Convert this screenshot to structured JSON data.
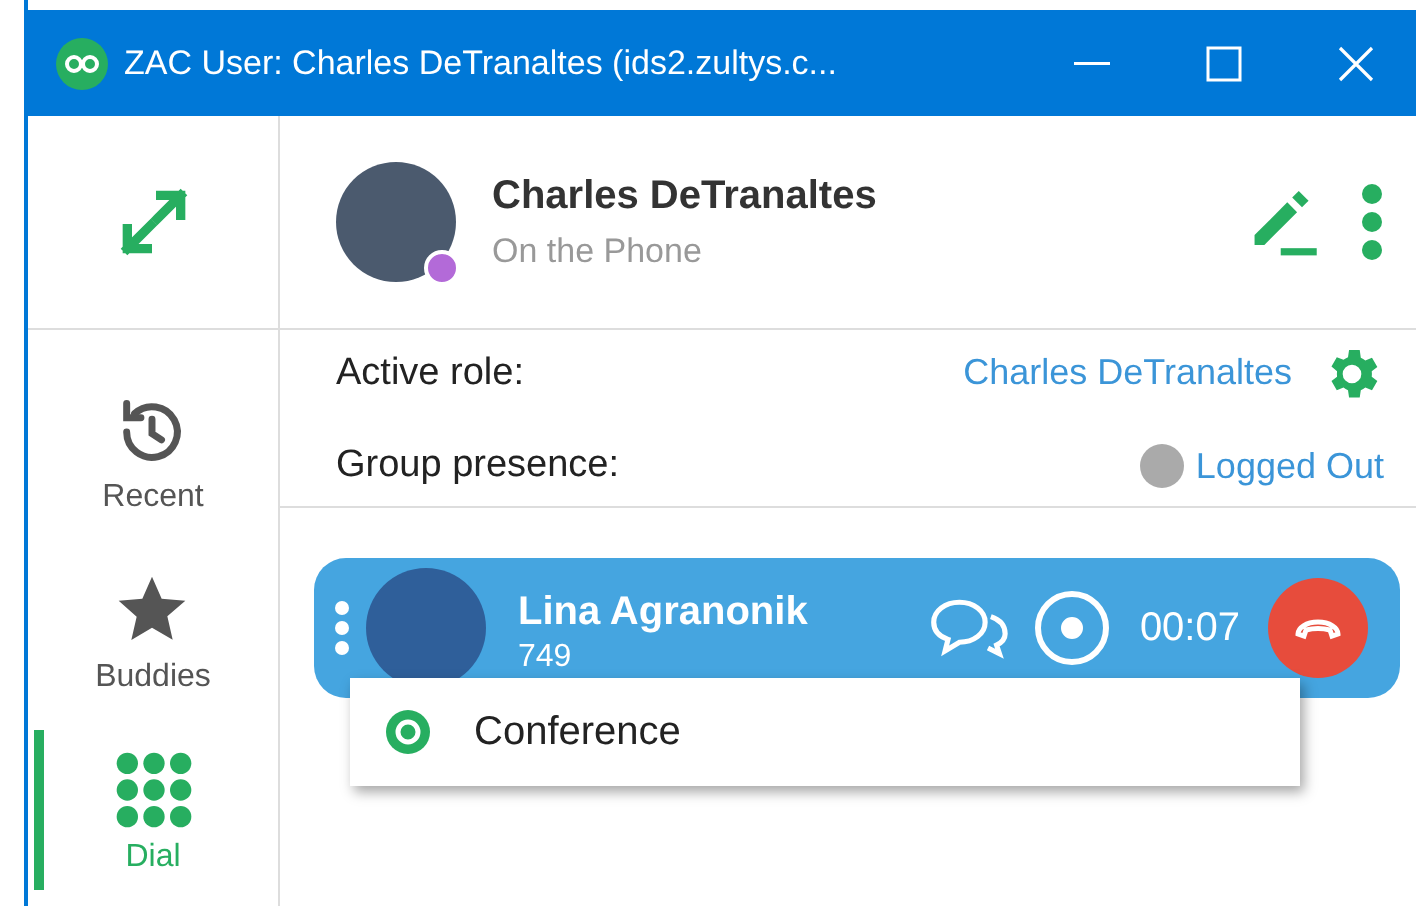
{
  "window": {
    "title": "ZAC User: Charles DeTranaltes (ids2.zultys.c..."
  },
  "sidebar": {
    "items": [
      {
        "kind": "recent",
        "label": "Recent",
        "selected": false
      },
      {
        "kind": "buddies",
        "label": "Buddies",
        "selected": false
      },
      {
        "kind": "dial",
        "label": "Dial",
        "selected": true
      }
    ]
  },
  "user": {
    "name": "Charles DeTranaltes",
    "status": "On the Phone"
  },
  "active_role": {
    "label": "Active role:",
    "value": "Charles DeTranaltes"
  },
  "group_presence": {
    "label": "Group presence:",
    "value": "Logged Out"
  },
  "call": {
    "name": "Lina Agranonik",
    "number": "749",
    "timer": "00:07"
  },
  "call_menu": {
    "items": [
      {
        "label": "Conference"
      }
    ]
  }
}
